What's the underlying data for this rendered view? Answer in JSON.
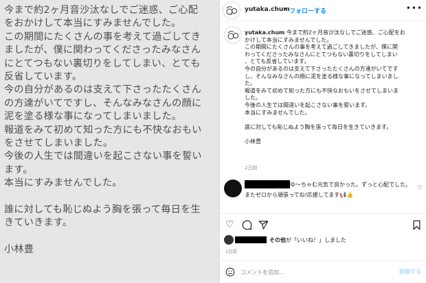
{
  "left_panel": {
    "lines": [
      "今まで約2ヶ月音沙汰なしでご迷惑、ご心配",
      "をおかけして本当にすみませんでした。",
      "この期間にたくさんの事を考えて過ごしてき",
      "ましたが、僕に関わってくださったみなさん",
      "にとてつもない裏切りをしてしまい、とても",
      "反省しています。",
      "今の自分があるのは支えて下さったたくさん",
      "の方達がいてですし、そんなみなさんの顔に",
      "泥を塗る様な事になってしまいました。",
      "報道をみて初めて知った方にも不快なおもい",
      "をさせてしまいました。",
      "今後の人生では間違いを起こさない事を誓い",
      "ます。",
      "本当にすみませんでした。",
      "",
      "誰に対しても恥じぬよう胸を張って毎日を生",
      "きていきます。",
      "",
      "小林豊"
    ]
  },
  "header": {
    "username": "yutaka.chum",
    "separator": "•",
    "follow_label": "フォローする",
    "more_icon": "more-horizontal-icon"
  },
  "caption": {
    "username": "yutaka.chum",
    "first_line": "今まで約2ヶ月音沙汰なしでご迷惑、ご心配をお",
    "lines": [
      "かけして本当にすみませんでした。",
      "この期間にたくさんの事を考えて過ごしてきましたが、僕に関",
      "わってくださったみなさんにとてつもない裏切りをしてしまい",
      "、とても反省しています。",
      "今の自分があるのは支えて下さったたくさんの方達がいてです",
      "し、そんなみなさんの顔に泥を塗る様な事になってしまいまし",
      "た。",
      "報道をみて初めて知った方にも不快なおもいをさせてしまいま",
      "した。",
      "今後の人生では間違いを起こさない事を誓います。",
      "本当にすみませんでした。",
      "",
      "誰に対しても恥じぬよう胸を張って毎日を生きていきます。",
      "",
      "小林豊"
    ],
    "time": "2日前"
  },
  "comment": {
    "text_line1": "ゆ〜ちゃむ元気で良かった。ずっと心配でした。",
    "text_line2": "またゼロから頑張ってね!応援してます📢👍",
    "like_icon": "heart-outline-icon"
  },
  "actions": {
    "icons": [
      "heart-outline-icon",
      "comment-bubble-icon",
      "send-paper-plane-icon",
      "bookmark-icon"
    ]
  },
  "likes": {
    "text_bold": "その他",
    "text_rest": "が「いいね！」しました"
  },
  "post_time": "2日前",
  "comment_box": {
    "placeholder": "コメントを追加...",
    "submit_label": "投稿する",
    "emoji_icon": "smiley-icon"
  },
  "colors": {
    "accent": "#0095f6",
    "left_bg": "#e6e6e6",
    "left_text": "#4f4f4f"
  }
}
